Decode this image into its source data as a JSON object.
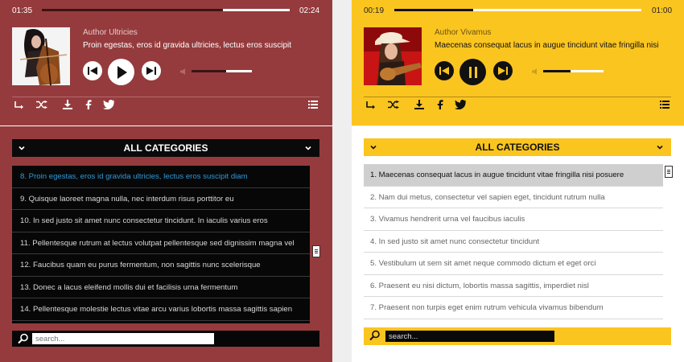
{
  "left_player": {
    "elapsed": "01:35",
    "duration": "02:24",
    "progress": 0.73,
    "author": "Author Ultricies",
    "title": "Proin egestas, eros id gravida ultricies, lectus eros suscipit",
    "volume": 0.57,
    "play_state": "paused",
    "cover": "woman playing cello"
  },
  "left_panel": {
    "category": "ALL CATEGORIES",
    "search_placeholder": "search...",
    "tracks": [
      "8. Proin egestas, eros id gravida ultricies, lectus eros suscipit diam",
      "9. Quisque laoreet magna nulla, nec interdum risus porttitor eu",
      "10. In sed justo sit amet nunc consectetur tincidunt. In iaculis varius eros",
      "11. Pellentesque rutrum at lectus volutpat pellentesque sed dignissim magna vel",
      "12. Faucibus quam eu purus fermentum, non sagittis nunc scelerisque",
      "13. Donec a lacus eleifend mollis dui et facilisis urna fermentum",
      "14. Pellentesque molestie lectus vitae arcu varius lobortis massa sagittis sapien"
    ],
    "active_index": 0
  },
  "right_player": {
    "elapsed": "00:19",
    "duration": "01:00",
    "progress": 0.32,
    "author": "Author Vivamus",
    "title": "Maecenas consequat lacus in augue tincidunt vitae fringilla nisi",
    "volume": 0.45,
    "play_state": "playing",
    "cover": "woman in hat playing guitar"
  },
  "right_panel": {
    "category": "ALL CATEGORIES",
    "search_placeholder": "search...",
    "tracks": [
      "1. Maecenas consequat lacus in augue tincidunt vitae fringilla nisi posuere",
      "2. Nam dui metus, consectetur vel sapien eget, tincidunt rutrum nulla",
      "3. Vivamus hendrerit urna vel faucibus iaculis",
      "4. In sed justo sit amet nunc consectetur tincidunt",
      "5. Vestibulum ut sem sit amet neque commodo dictum et eget orci",
      "6. Praesent eu nisi dictum, lobortis massa sagittis, imperdiet nisl",
      "7. Praesent non turpis eget enim rutrum vehicula vivamus bibendum"
    ],
    "active_index": 0
  },
  "icons": [
    "repeat-icon",
    "shuffle-icon",
    "download-icon",
    "facebook-icon",
    "twitter-icon",
    "playlist-menu-icon",
    "prev-icon",
    "play-icon",
    "pause-icon",
    "next-icon",
    "volume-icon",
    "chevron-down-icon",
    "search-icon"
  ],
  "colors": {
    "left_accent": "#953b3d",
    "right_accent": "#fbc520",
    "active_link": "#2b9bdc",
    "list_dark": "#070707"
  }
}
